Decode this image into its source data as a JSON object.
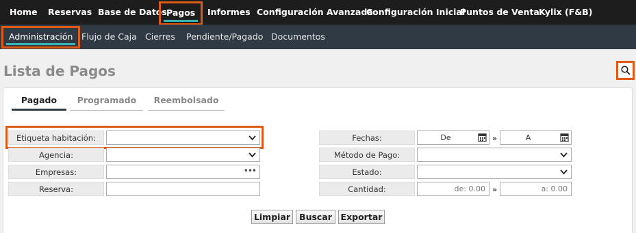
{
  "topnav": {
    "items": [
      "Home",
      "Reservas",
      "Base de Datos",
      "Pagos",
      "Informes",
      "Configuración Avanzada",
      "Configuración Inicial",
      "Puntos de Venta",
      "Kylix (F&B)"
    ],
    "active": "Pagos"
  },
  "subnav": {
    "items": [
      "Administración",
      "Flujo de Caja",
      "Cierres",
      "Pendiente/Pagado",
      "Documentos"
    ],
    "active": "Administración"
  },
  "page_title": "Lista de Pagos",
  "tabs": [
    "Pagado",
    "Programado",
    "Reembolsado"
  ],
  "active_tab": "Pagado",
  "form": {
    "left": [
      {
        "label": "Etiqueta habitación:",
        "value": ""
      },
      {
        "label": "Agencia:",
        "value": ""
      },
      {
        "label": "Empresas:",
        "value": ""
      },
      {
        "label": "Reserva:",
        "value": ""
      }
    ],
    "right": {
      "fechas_label": "Fechas:",
      "fecha_desde": "De",
      "fecha_hasta": "A",
      "metodo_label": "Método de Pago:",
      "estado_label": "Estado:",
      "cantidad_label": "Cantidad:",
      "cantidad_desde_placeholder": "de: 0.00",
      "cantidad_hasta_placeholder": "a: 0.00",
      "range_separator": "»"
    }
  },
  "buttons": {
    "clear": "Limpiar",
    "search": "Buscar",
    "export": "Exportar"
  },
  "colors": {
    "topnav": "#1d1d1d",
    "subnav": "#2f3a45",
    "highlight": "#e05a16",
    "active_underline": "#37b4b4"
  }
}
